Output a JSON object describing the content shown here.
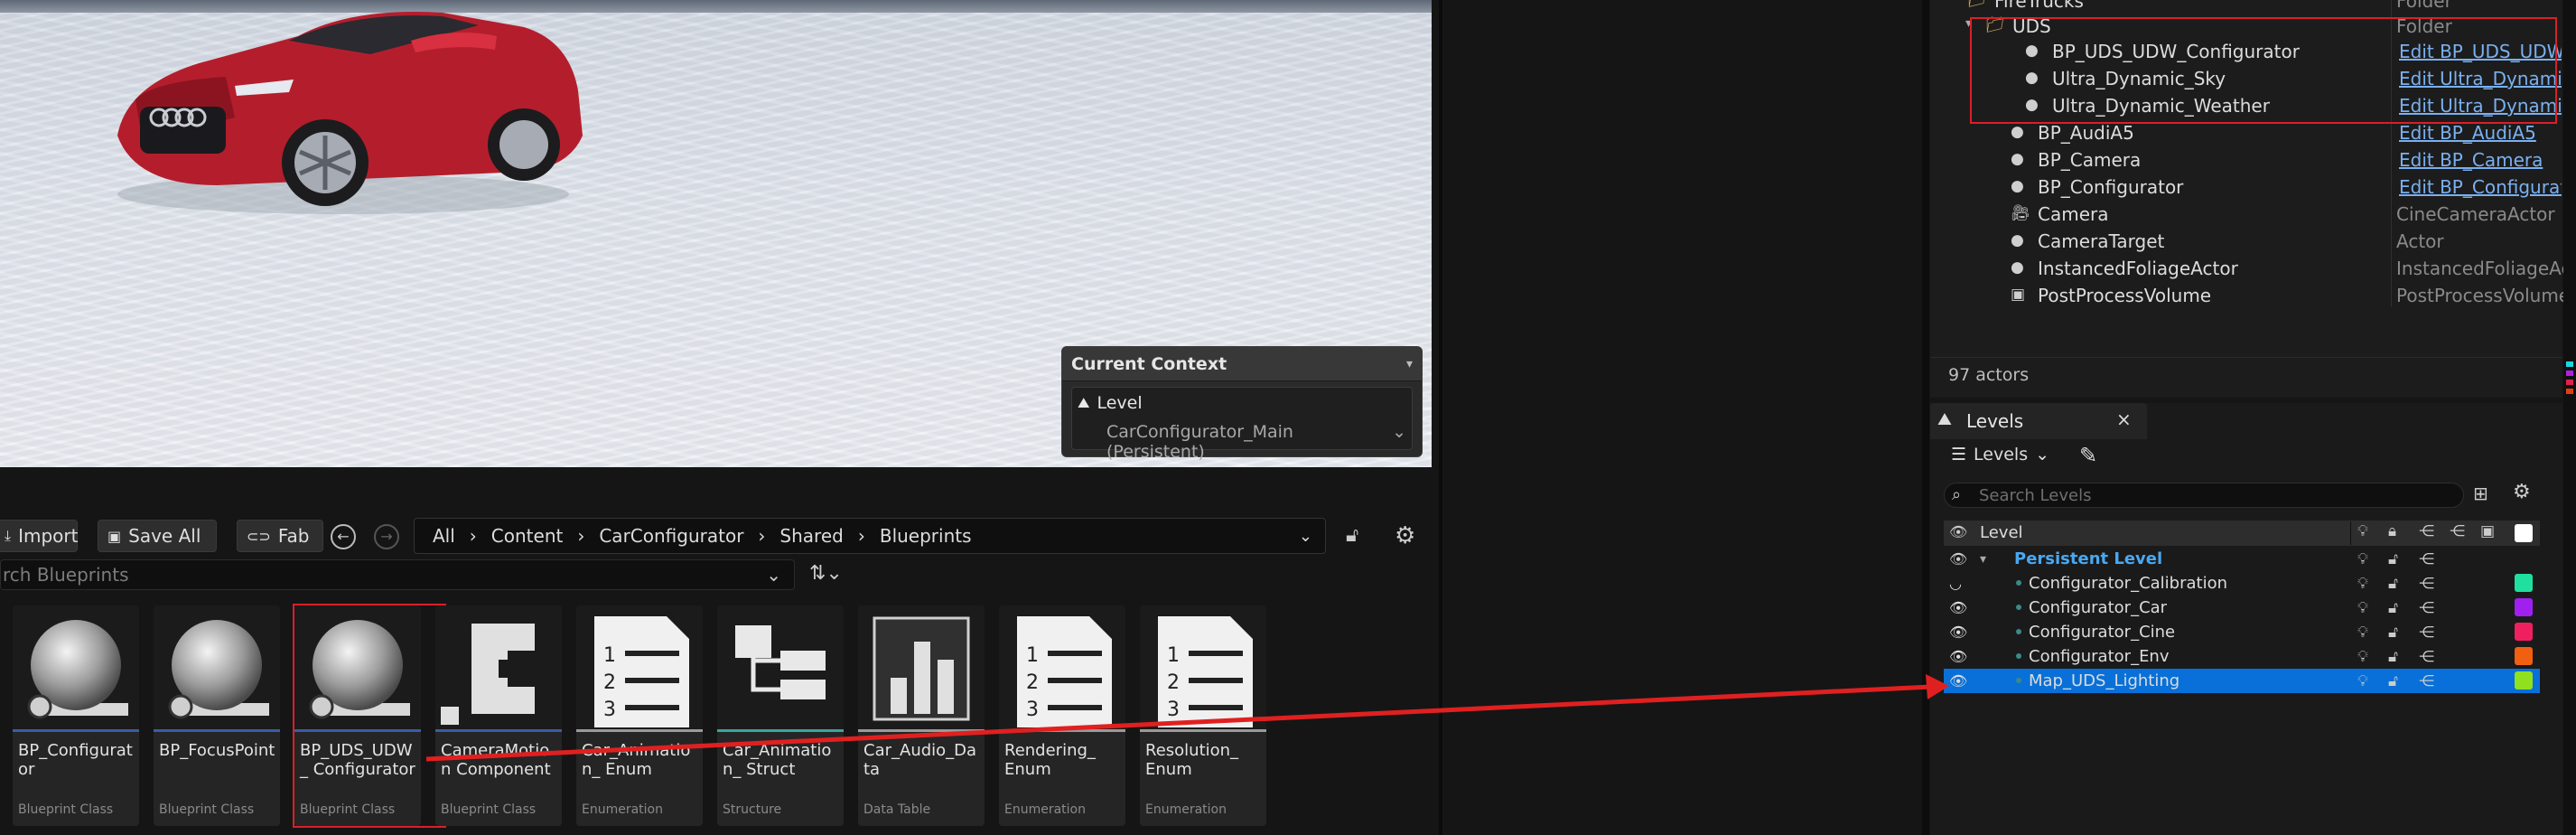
{
  "viewport": {
    "context_panel": {
      "title": "Current Context",
      "level_label": "Level",
      "level_value": "CarConfigurator_Main (Persistent)"
    }
  },
  "content_browser": {
    "toolbar": {
      "import_label": "Import",
      "save_all_label": "Save All",
      "fab_label": "Fab"
    },
    "path": [
      "All",
      "Content",
      "CarConfigurator",
      "Shared",
      "Blueprints"
    ],
    "search_placeholder": "rch Blueprints",
    "assets": [
      {
        "name": "BP_Configurator",
        "type": "Blueprint Class",
        "icon": "blueprint-sphere-icon"
      },
      {
        "name": "BP_FocusPoint",
        "type": "Blueprint Class",
        "icon": "blueprint-sphere-icon"
      },
      {
        "name": "BP_UDS_UDW_ Configurator",
        "type": "Blueprint Class",
        "icon": "blueprint-sphere-icon"
      },
      {
        "name": "CameraMotion Component",
        "type": "Blueprint Class",
        "icon": "component-icon"
      },
      {
        "name": "Car_Animation_ Enum",
        "type": "Enumeration",
        "icon": "enum-list-icon"
      },
      {
        "name": "Car_Animation_ Struct",
        "type": "Structure",
        "icon": "struct-icon"
      },
      {
        "name": "Car_Audio_Data",
        "type": "Data Table",
        "icon": "data-table-icon"
      },
      {
        "name": "Rendering_ Enum",
        "type": "Enumeration",
        "icon": "enum-list-icon"
      },
      {
        "name": "Resolution_ Enum",
        "type": "Enumeration",
        "icon": "enum-list-icon"
      }
    ]
  },
  "outliner": {
    "rows": [
      {
        "label": "FireTrucks",
        "type": "Folder",
        "kind": "folder"
      },
      {
        "label": "UDS",
        "type": "Folder",
        "kind": "folder"
      },
      {
        "label": "BP_UDS_UDW_Configurator",
        "type": "Edit BP_UDS_UDW_",
        "kind": "actor"
      },
      {
        "label": "Ultra_Dynamic_Sky",
        "type": "Edit Ultra_Dynamic_",
        "kind": "actor"
      },
      {
        "label": "Ultra_Dynamic_Weather",
        "type": "Edit Ultra_Dynamic_",
        "kind": "actor"
      },
      {
        "label": "BP_AudiA5",
        "type": "Edit BP_AudiA5",
        "kind": "actor"
      },
      {
        "label": "BP_Camera",
        "type": "Edit BP_Camera",
        "kind": "actor"
      },
      {
        "label": "BP_Configurator",
        "type": "Edit BP_Configurato",
        "kind": "actor"
      },
      {
        "label": "Camera",
        "type": "CineCameraActor",
        "kind": "camera"
      },
      {
        "label": "CameraTarget",
        "type": "Actor",
        "kind": "actor"
      },
      {
        "label": "InstancedFoliageActor",
        "type": "InstancedFoliageAc",
        "kind": "actor"
      },
      {
        "label": "PostProcessVolume",
        "type": "PostProcessVolume",
        "kind": "volume"
      }
    ],
    "actor_count": "97 actors"
  },
  "levels_panel": {
    "tab_label": "Levels",
    "dropdown_label": "Levels",
    "search_placeholder": "Search Levels",
    "column_header": "Level",
    "persistent_level": "Persistent Level",
    "sublevels": [
      {
        "name": "Configurator_Calibration",
        "color": "#20e0a0"
      },
      {
        "name": "Configurator_Car",
        "color": "#a020f0"
      },
      {
        "name": "Configurator_Cine",
        "color": "#f02060"
      },
      {
        "name": "Configurator_Env",
        "color": "#f06010"
      },
      {
        "name": "Map_UDS_Lighting",
        "color": "#90e020"
      }
    ]
  },
  "colors": {
    "selection": "#0870d8",
    "link": "#7ab0f0",
    "highlight_box": "#d8202a",
    "arrow": "#e02020"
  }
}
